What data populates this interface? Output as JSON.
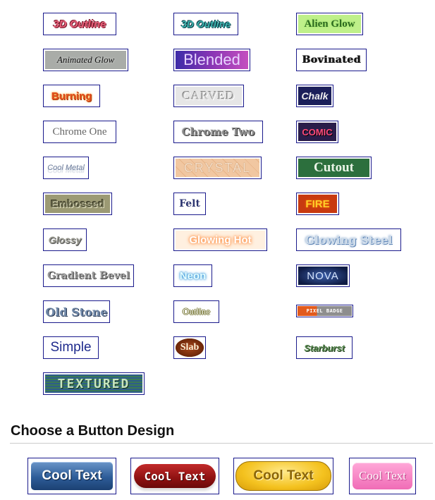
{
  "logos": [
    {
      "label": "3D Outline"
    },
    {
      "label": "3D Outline"
    },
    {
      "label": "Alien Glow"
    },
    {
      "label": "Animated Glow"
    },
    {
      "label": "Blended"
    },
    {
      "label": "Bovinated"
    },
    {
      "label": "Burning"
    },
    {
      "label": "CARVED"
    },
    {
      "label": "Chalk"
    },
    {
      "label": "Chrome One"
    },
    {
      "label": "Chrome Two"
    },
    {
      "label": "COMIC"
    },
    {
      "label": "Cool Metal"
    },
    {
      "label": "CRYSTAL"
    },
    {
      "label": "Cutout"
    },
    {
      "label": "Embossed"
    },
    {
      "label": "Felt"
    },
    {
      "label": "FIRE"
    },
    {
      "label": "Glossy"
    },
    {
      "label": "Glowing Hot"
    },
    {
      "label": "Glowing Steel"
    },
    {
      "label": "Gradient Bevel"
    },
    {
      "label": "Neon"
    },
    {
      "label": "NOVA"
    },
    {
      "label": "Old Stone"
    },
    {
      "label": "Outline"
    },
    {
      "label": "PIXEL BADGE"
    },
    {
      "label": "Simple"
    },
    {
      "label": "Slab"
    },
    {
      "label": "Starburst"
    },
    {
      "label": "TEXTURED"
    }
  ],
  "button_section": {
    "heading": "Choose a Button Design",
    "buttons": [
      {
        "label": "Cool Text"
      },
      {
        "label": "Cool Text"
      },
      {
        "label": "Cool Text"
      },
      {
        "label": "Cool Text"
      }
    ]
  }
}
